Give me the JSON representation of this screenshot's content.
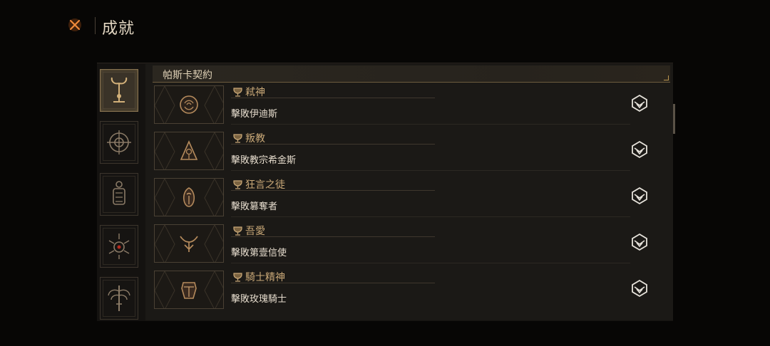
{
  "title": "成就",
  "category_header": "帕斯卡契約",
  "categories": [
    {
      "icon": "ornate-trident-icon",
      "active": true
    },
    {
      "icon": "target-sigil-icon",
      "active": false
    },
    {
      "icon": "lantern-icon",
      "active": false
    },
    {
      "icon": "spiked-eye-icon",
      "active": false
    },
    {
      "icon": "wing-sword-icon",
      "active": false
    }
  ],
  "achievements": [
    {
      "name": "弒神",
      "description": "擊敗伊迪斯",
      "icon": "rose-bloom-icon"
    },
    {
      "name": "叛教",
      "description": "擊敗教宗希金斯",
      "icon": "hooded-pope-icon"
    },
    {
      "name": "狂言之徒",
      "description": "擊敗篡奪者",
      "icon": "robed-figure-icon"
    },
    {
      "name": "吾愛",
      "description": "擊敗第壹信使",
      "icon": "horned-crown-icon"
    },
    {
      "name": "騎士精神",
      "description": "擊敗玫瑰騎士",
      "icon": "knight-helm-icon"
    }
  ],
  "colors": {
    "accent": "#caa978",
    "highlight": "#e77a2a",
    "background": "#070605"
  }
}
